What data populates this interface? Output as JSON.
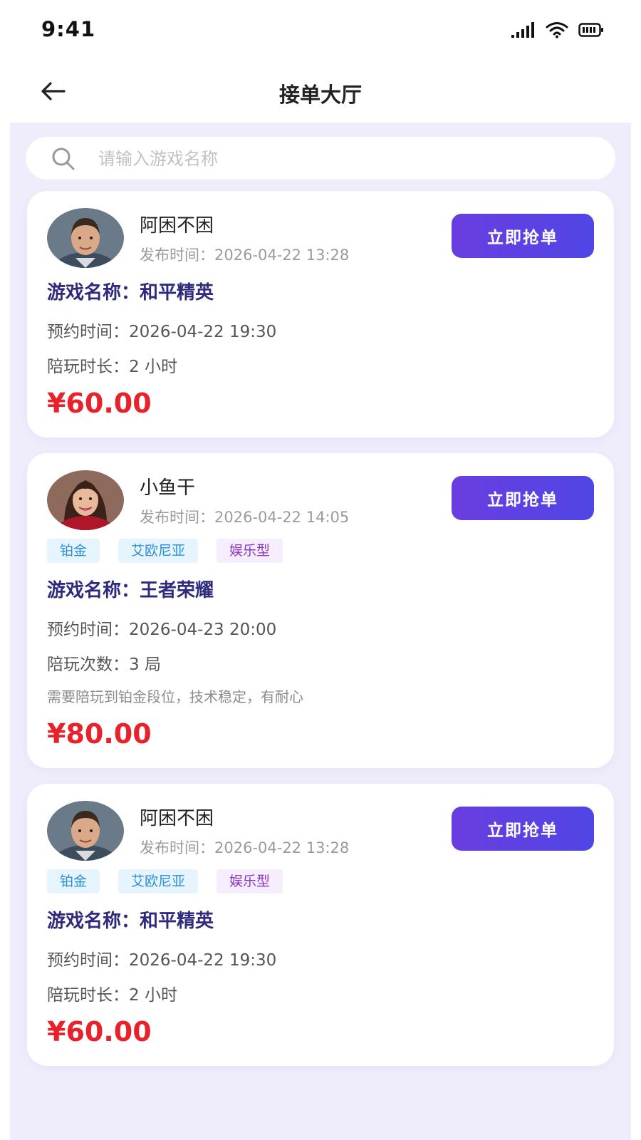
{
  "status_bar": {
    "time": "9:41",
    "icons": [
      "signal-icon",
      "wifi-icon",
      "battery-icon"
    ]
  },
  "header": {
    "title": "接单大厅",
    "back_icon": "back-arrow-icon"
  },
  "search": {
    "placeholder": "请输入游戏名称",
    "value": ""
  },
  "colors": {
    "accent": "#5b43e3",
    "price": "#e8212b",
    "game_name": "#2e2a7e",
    "background": "#efecfb"
  },
  "orders": [
    {
      "user_name": "阿困不困",
      "publish_time": "发布时间：2026-04-22 13:28",
      "button_label": "立即抢单",
      "tags": [],
      "game_name": "游戏名称：和平精英",
      "appointment": "预约时间：2026-04-22 19:30",
      "duration": "陪玩时长：2 小时",
      "note": "",
      "price": "¥60.00"
    },
    {
      "user_name": "小鱼干",
      "publish_time": "发布时间：2026-04-22 14:05",
      "button_label": "立即抢单",
      "tags": [
        "铂金",
        "艾欧尼亚",
        "娱乐型"
      ],
      "game_name": "游戏名称：王者荣耀",
      "appointment": "预约时间：2026-04-23 20:00",
      "duration": "陪玩次数：3 局",
      "note": "需要陪玩到铂金段位，技术稳定，有耐心",
      "price": "¥80.00"
    },
    {
      "user_name": "阿困不困",
      "publish_time": "发布时间：2026-04-22 13:28",
      "button_label": "立即抢单",
      "tags": [
        "铂金",
        "艾欧尼亚",
        "娱乐型"
      ],
      "game_name": "游戏名称：和平精英",
      "appointment": "预约时间：2026-04-22 19:30",
      "duration": "陪玩时长：2 小时",
      "note": "",
      "price": "¥60.00"
    }
  ]
}
